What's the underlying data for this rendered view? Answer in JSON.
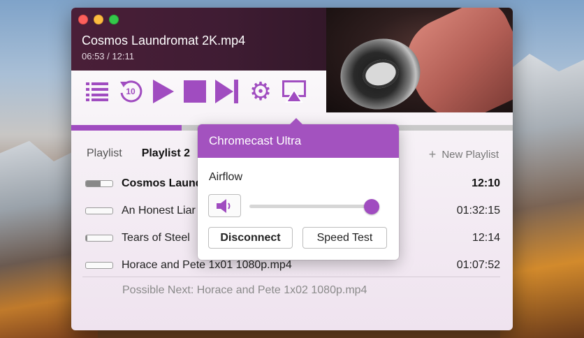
{
  "window": {
    "now_playing": {
      "title": "Cosmos Laundromat 2K.mp4",
      "time": "06:53 / 12:11"
    },
    "controls": {
      "rewind_label": "10",
      "icons": [
        "playlist-icon",
        "rewind-10-icon",
        "play-icon",
        "stop-icon",
        "next-icon",
        "gear-icon",
        "airplay-icon"
      ]
    },
    "progress": 0.25,
    "tabs": [
      {
        "label": "Playlist"
      },
      {
        "label": "Playlist 2"
      }
    ],
    "new_playlist_label": "New Playlist",
    "playlist": [
      {
        "name": "Cosmos Laundromat 2K.mp4",
        "duration": "12:10",
        "progress": 0.56,
        "active": true
      },
      {
        "name": "An Honest Liar",
        "duration": "01:32:15",
        "progress": 0.0,
        "active": false
      },
      {
        "name": "Tears of Steel",
        "duration": "12:14",
        "progress": 0.05,
        "active": false
      },
      {
        "name": "Horace and Pete 1x01 1080p.mp4",
        "duration": "01:07:52",
        "progress": 0.0,
        "active": false
      }
    ],
    "possible_next": "Possible Next: Horace and Pete 1x02 1080p.mp4"
  },
  "popover": {
    "header": "Chromecast Ultra",
    "device": "Airflow",
    "volume": 1.0,
    "disconnect_label": "Disconnect",
    "speed_test_label": "Speed Test"
  },
  "colors": {
    "accent": "#a04cc0",
    "title_bg": "#4a1f38"
  }
}
